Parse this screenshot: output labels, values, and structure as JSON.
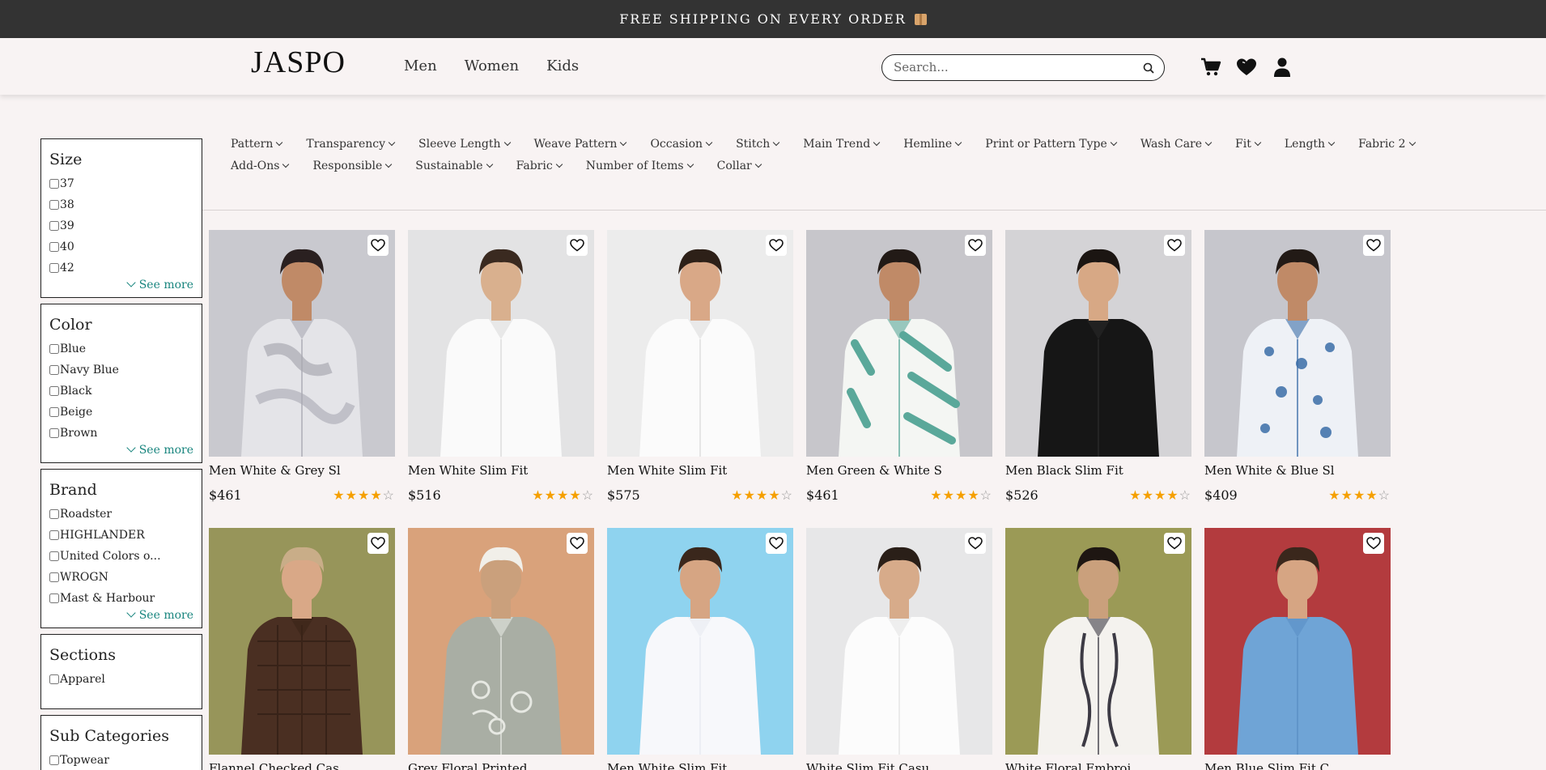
{
  "announcement": {
    "text": "FREE SHIPPING ON EVERY ORDER"
  },
  "header": {
    "logo": "JASPO",
    "nav": [
      "Men",
      "Women",
      "Kids"
    ],
    "search_placeholder": "Search..."
  },
  "sidebar": {
    "size": {
      "title": "Size",
      "options": [
        "37",
        "38",
        "39",
        "40",
        "42"
      ],
      "see_more": "See more"
    },
    "color": {
      "title": "Color",
      "options": [
        "Blue",
        "Navy Blue",
        "Black",
        "Beige",
        "Brown"
      ],
      "see_more": "See more"
    },
    "brand": {
      "title": "Brand",
      "options": [
        "Roadster",
        "HIGHLANDER",
        "United Colors o...",
        "WROGN",
        "Mast & Harbour"
      ],
      "see_more": "See more"
    },
    "sections": {
      "title": "Sections",
      "options": [
        "Apparel"
      ]
    },
    "sub_categories": {
      "title": "Sub Categories",
      "options": [
        "Topwear"
      ]
    }
  },
  "filters": [
    "Pattern",
    "Transparency",
    "Sleeve Length",
    "Weave Pattern",
    "Occasion",
    "Stitch",
    "Main Trend",
    "Hemline",
    "Print or Pattern Type",
    "Wash Care",
    "Fit",
    "Length",
    "Fabric 2",
    "Add-Ons",
    "Responsible",
    "Sustainable",
    "Fabric",
    "Number of Items",
    "Collar"
  ],
  "products": [
    {
      "name": "Men White & Grey Sl",
      "price": "$461",
      "rating": 4
    },
    {
      "name": "Men White Slim Fit",
      "price": "$516",
      "rating": 4
    },
    {
      "name": "Men White Slim Fit",
      "price": "$575",
      "rating": 4
    },
    {
      "name": "Men Green & White S",
      "price": "$461",
      "rating": 4
    },
    {
      "name": "Men Black Slim Fit",
      "price": "$526",
      "rating": 4
    },
    {
      "name": "Men White & Blue Sl",
      "price": "$409",
      "rating": 4
    },
    {
      "name": "Flannel Checked Cas",
      "price": "",
      "rating": 0
    },
    {
      "name": "Grey Floral Printed",
      "price": "",
      "rating": 0
    },
    {
      "name": "Men White Slim Fit",
      "price": "",
      "rating": 0
    },
    {
      "name": "White Slim Fit Casu",
      "price": "",
      "rating": 0
    },
    {
      "name": "White Floral Embroi",
      "price": "",
      "rating": 0
    },
    {
      "name": "Men Blue Slim Fit C",
      "price": "",
      "rating": 0
    }
  ],
  "colors": {
    "topbar": "#333333",
    "accent": "#18857e",
    "star": "#f5a000",
    "background": "#f8f3f3"
  }
}
